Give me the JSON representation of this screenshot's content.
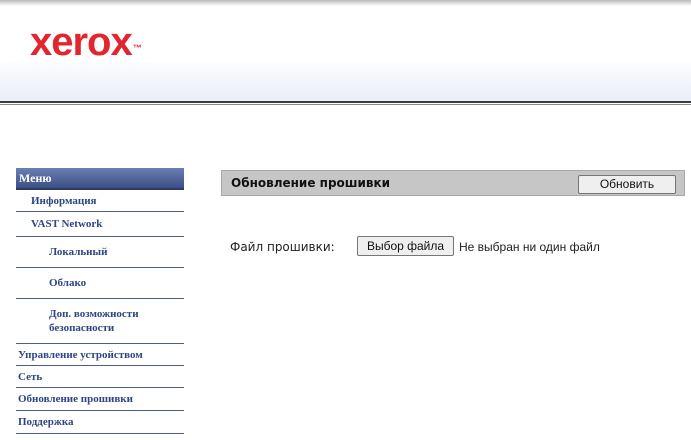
{
  "header": {
    "logo": "xerox",
    "logo_tm": "™"
  },
  "menu": {
    "title": "Меню",
    "items": [
      {
        "label": "Информация"
      },
      {
        "label": "VAST Network"
      },
      {
        "label": "Локальный"
      },
      {
        "label": "Облако"
      },
      {
        "label": "Доп. возможности безопасности"
      },
      {
        "label": "Управление устройством"
      },
      {
        "label": "Сеть"
      },
      {
        "label": "Обновление прошивки"
      },
      {
        "label": "Поддержка"
      }
    ]
  },
  "panel": {
    "title": "Обновление прошивки",
    "update_button": "Обновить"
  },
  "file": {
    "label": "Файл прошивки:",
    "choose_button": "Выбор файла",
    "status": "Не выбран ни один файл"
  },
  "colors": {
    "brand": "#e0262f",
    "menu_header": "#3c4f85",
    "menu_text": "#2d4582",
    "panel_bar": "#c6c6c6"
  }
}
